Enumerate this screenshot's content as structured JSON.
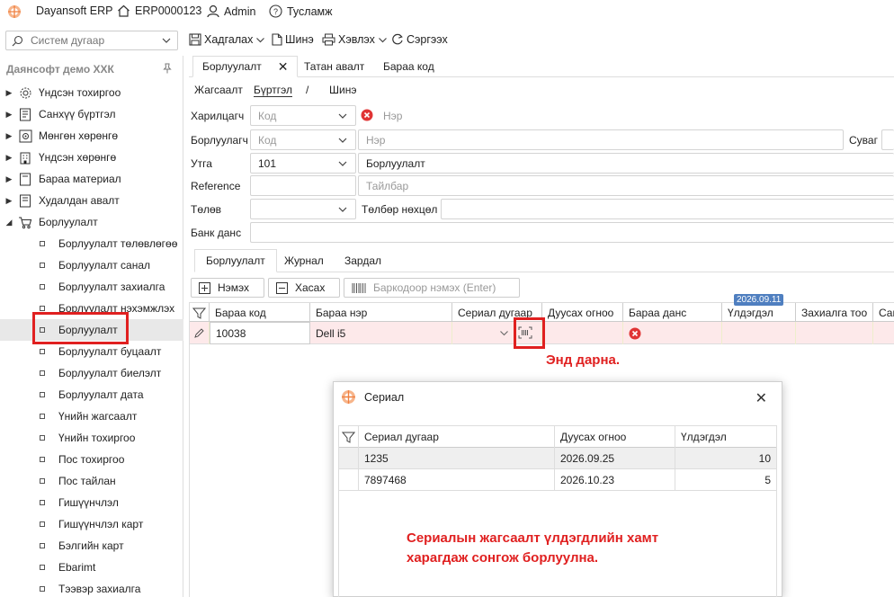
{
  "app": {
    "title": "Dayansoft ERP",
    "db": "ERP0000123",
    "user": "Admin",
    "help": "Тусламж"
  },
  "toolbar": {
    "search_placeholder": "Систем дугаар",
    "save": "Хадгалах",
    "new": "Шинэ",
    "print": "Хэвлэх",
    "refresh": "Сэргээх"
  },
  "sidebar": {
    "company": "Даянсофт демо ХХК",
    "items": [
      {
        "label": "Үндсэн тохиргоо",
        "icon": "gear-icon"
      },
      {
        "label": "Санхүү бүртгэл",
        "icon": "ledger-icon"
      },
      {
        "label": "Мөнгөн хөрөнгө",
        "icon": "safe-icon"
      },
      {
        "label": "Үндсэн хөрөнгө",
        "icon": "building-icon"
      },
      {
        "label": "Бараа материал",
        "icon": "box-icon"
      },
      {
        "label": "Худалдан авалт",
        "icon": "purchase-icon"
      },
      {
        "label": "Борлуулалт",
        "icon": "cart-icon"
      }
    ],
    "sub_items": [
      "Борлуулалт төлөвлөгөө",
      "Борлуулалт санал",
      "Борлуулалт захиалга",
      "Борлуулалт нэхэмжлэх",
      "Борлуулалт",
      "Борлуулалт буцаалт",
      "Борлуулалт биелэлт",
      "Борлуулалт дата",
      "Үнийн жагсаалт",
      "Үнийн тохиргоо",
      "Пос тохиргоо",
      "Пос тайлан",
      "Гишүүнчлэл",
      "Гишүүнчлэл карт",
      "Бэлгийн карт",
      "Ebarimt",
      "Тээвэр захиалга"
    ]
  },
  "tabs": [
    "Борлуулалт",
    "Татан авалт",
    "Бараа код"
  ],
  "subnav": {
    "list": "Жагсаалт",
    "register": "Бүртгэл",
    "sep": "/",
    "new": "Шинэ"
  },
  "form": {
    "customer_label": "Харилцагч",
    "customer_code_ph": "Код",
    "customer_name_ph": "Нэр",
    "seller_label": "Борлуулагч",
    "seller_code_ph": "Код",
    "seller_name_ph": "Нэр",
    "channel_label": "Суваг",
    "type_label": "Утга",
    "type_code": "101",
    "type_name": "Борлуулалт",
    "reference_label": "Reference",
    "description_ph": "Тайлбар",
    "status_label": "Төлөв",
    "payment_label": "Төлбөр нөхцөл",
    "bank_label": "Банк данс"
  },
  "inner_tabs": [
    "Борлуулалт",
    "Журнал",
    "Зардал"
  ],
  "grid_buttons": {
    "add": "Нэмэх",
    "remove": "Хасах",
    "barcode_ph": "Баркодоор нэмэх (Enter)"
  },
  "grid": {
    "columns": [
      "Бараа код",
      "Бараа нэр",
      "Сериал дугаар",
      "Дуусах огноо",
      "Бараа данс",
      "Үлдэгдэл",
      "Захиалга тоо",
      "Сав"
    ],
    "date_badge": "2026.09.11",
    "row": {
      "code": "10038",
      "name": "Dell i5"
    }
  },
  "annotations": {
    "click_here": "Энд дарна.",
    "explain_line1": "Сериалын жагсаалт үлдэгдлийн хамт",
    "explain_line2": "харагдаж сонгож борлуулна."
  },
  "dialog": {
    "title": "Сериал",
    "columns": [
      "Сериал дугаар",
      "Дуусах огноо",
      "Үлдэгдэл"
    ],
    "rows": [
      {
        "serial": "1235",
        "expiry": "2026.09.25",
        "qty": "10"
      },
      {
        "serial": "7897468",
        "expiry": "2026.10.23",
        "qty": "5"
      }
    ]
  },
  "colors": {
    "accent_red": "#e02020",
    "row_highlight": "#fde9ea",
    "badge_blue": "#4f7fc0"
  }
}
